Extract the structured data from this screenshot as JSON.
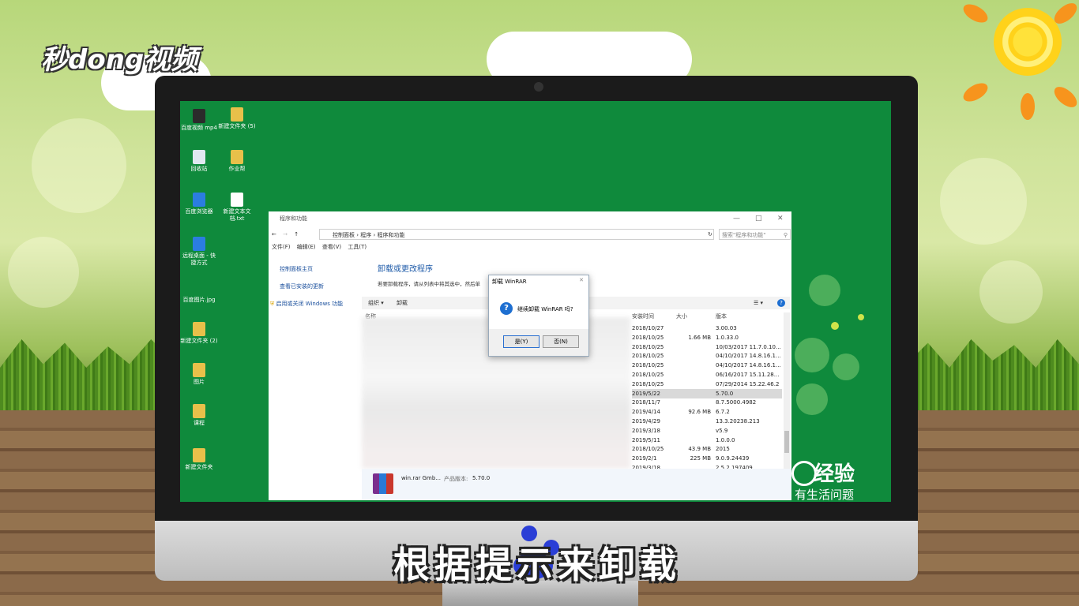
{
  "brand": {
    "logo_text": "秒dong视频"
  },
  "desktop_icons": [
    {
      "label": "百度视频 mp4",
      "color": "#2b2b2b"
    },
    {
      "label": "新建文件夹 (5)",
      "color": "#e8c04a"
    },
    {
      "label": "回收站",
      "color": "#dfe8f0"
    },
    {
      "label": "作业帮",
      "color": "#e8c04a"
    },
    {
      "label": "百度浏览器",
      "color": "#2b7de0"
    },
    {
      "label": "新建文本文档.txt",
      "color": "#ffffff"
    },
    {
      "label": "远程桌面 - 快捷方式",
      "color": "#2b7de0"
    },
    {
      "label": "百度图片.jpg",
      "color": "#0f8a3c"
    },
    {
      "label": "新建文件夹 (2)",
      "color": "#e8c04a"
    },
    {
      "label": "图片",
      "color": "#e8c04a"
    },
    {
      "label": "课程",
      "color": "#e8c04a"
    },
    {
      "label": "新建文件夹",
      "color": "#e8c04a"
    }
  ],
  "window": {
    "title": "程序和功能",
    "breadcrumb": [
      "控制面板",
      "程序",
      "程序和功能"
    ],
    "search_placeholder": "搜索\"程序和功能\"",
    "menu": [
      "文件(F)",
      "编辑(E)",
      "查看(V)",
      "工具(T)"
    ],
    "left_links": [
      "控制面板主页",
      "查看已安装的更新",
      "启用或关闭 Windows 功能"
    ],
    "heading": "卸载或更改程序",
    "subheading": "若要卸载程序，请从列表中将其选中，然后单",
    "toolbar": {
      "organize": "组织 ▾",
      "uninstall": "卸载"
    },
    "columns": {
      "name": "名称",
      "installed": "安装时间",
      "size": "大小",
      "version": "版本"
    },
    "rows": [
      {
        "date": "2018/10/27",
        "size": "",
        "version": "3.00.03"
      },
      {
        "date": "2018/10/25",
        "size": "1.66 MB",
        "version": "1.0.33.0"
      },
      {
        "date": "2018/10/25",
        "size": "",
        "version": "10/03/2017 11.7.0.10..."
      },
      {
        "date": "2018/10/25",
        "size": "",
        "version": "04/10/2017 14.8.16.1..."
      },
      {
        "date": "2018/10/25",
        "size": "",
        "version": "04/10/2017 14.8.16.1..."
      },
      {
        "date": "2018/10/25",
        "size": "",
        "version": "06/16/2017 15.11.28..."
      },
      {
        "date": "2018/10/25",
        "size": "",
        "version": "07/29/2014 15.22.46.2"
      },
      {
        "date": "2019/5/22",
        "size": "",
        "version": "5.70.0",
        "selected": true
      },
      {
        "date": "2018/11/7",
        "size": "",
        "version": "8.7.5000.4982"
      },
      {
        "date": "2019/4/14",
        "size": "92.6 MB",
        "version": "6.7.2"
      },
      {
        "date": "2019/4/29",
        "size": "",
        "version": "13.3.20238.213"
      },
      {
        "date": "2019/3/18",
        "size": "",
        "version": "v5.9"
      },
      {
        "date": "2019/5/11",
        "size": "",
        "version": "1.0.0.0"
      },
      {
        "date": "2018/10/25",
        "size": "43.9 MB",
        "version": "2015"
      },
      {
        "date": "2019/2/1",
        "size": "225 MB",
        "version": "9.0.9.24439"
      },
      {
        "date": "2019/3/18",
        "size": "",
        "version": "2.5.2.197409"
      }
    ],
    "details": {
      "publisher": "win.rar Gmb...",
      "version_label": "产品版本:",
      "version": "5.70.0"
    }
  },
  "dialog": {
    "title": "卸载 WinRAR",
    "message": "继续卸载 WinRAR 吗?",
    "yes": "是(Y)",
    "no": "否(N)"
  },
  "baidu": {
    "brand": "经验",
    "slogan": "有生活问题"
  },
  "caption": "根据提示来卸载"
}
